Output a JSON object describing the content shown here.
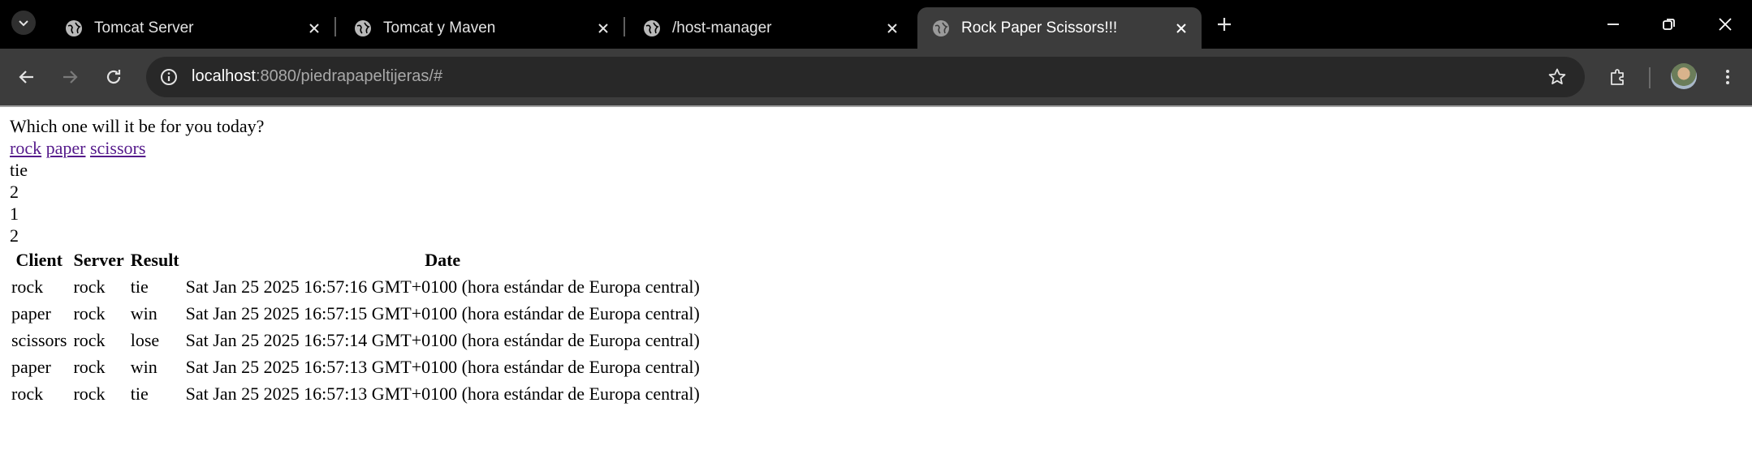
{
  "browser": {
    "tabs": [
      {
        "title": "Tomcat Server",
        "active": false,
        "icon": "globe-icon"
      },
      {
        "title": "Tomcat y Maven",
        "active": false,
        "icon": "globe-icon"
      },
      {
        "title": "/host-manager",
        "active": false,
        "icon": "globe-icon"
      },
      {
        "title": "Rock Paper Scissors!!!",
        "active": true,
        "icon": "globe-icon"
      }
    ],
    "url_host": "localhost",
    "url_rest": ":8080/piedrapapeltijeras/#",
    "colors": {
      "tabstrip": "#000000",
      "toolbar": "#3c3c3c",
      "omnibox": "#282828"
    }
  },
  "page": {
    "prompt": "Which one will it be for you today?",
    "choices": [
      "rock",
      "paper",
      "scissors"
    ],
    "result": "tie",
    "stats": [
      "2",
      "1",
      "2"
    ],
    "table": {
      "headers": [
        "Client",
        "Server",
        "Result",
        "Date"
      ],
      "rows": [
        [
          "rock",
          "rock",
          "tie",
          "Sat Jan 25 2025 16:57:16 GMT+0100 (hora estándar de Europa central)"
        ],
        [
          "paper",
          "rock",
          "win",
          "Sat Jan 25 2025 16:57:15 GMT+0100 (hora estándar de Europa central)"
        ],
        [
          "scissors",
          "rock",
          "lose",
          "Sat Jan 25 2025 16:57:14 GMT+0100 (hora estándar de Europa central)"
        ],
        [
          "paper",
          "rock",
          "win",
          "Sat Jan 25 2025 16:57:13 GMT+0100 (hora estándar de Europa central)"
        ],
        [
          "rock",
          "rock",
          "tie",
          "Sat Jan 25 2025 16:57:13 GMT+0100 (hora estándar de Europa central)"
        ]
      ]
    },
    "link_color": "#551a8b"
  }
}
